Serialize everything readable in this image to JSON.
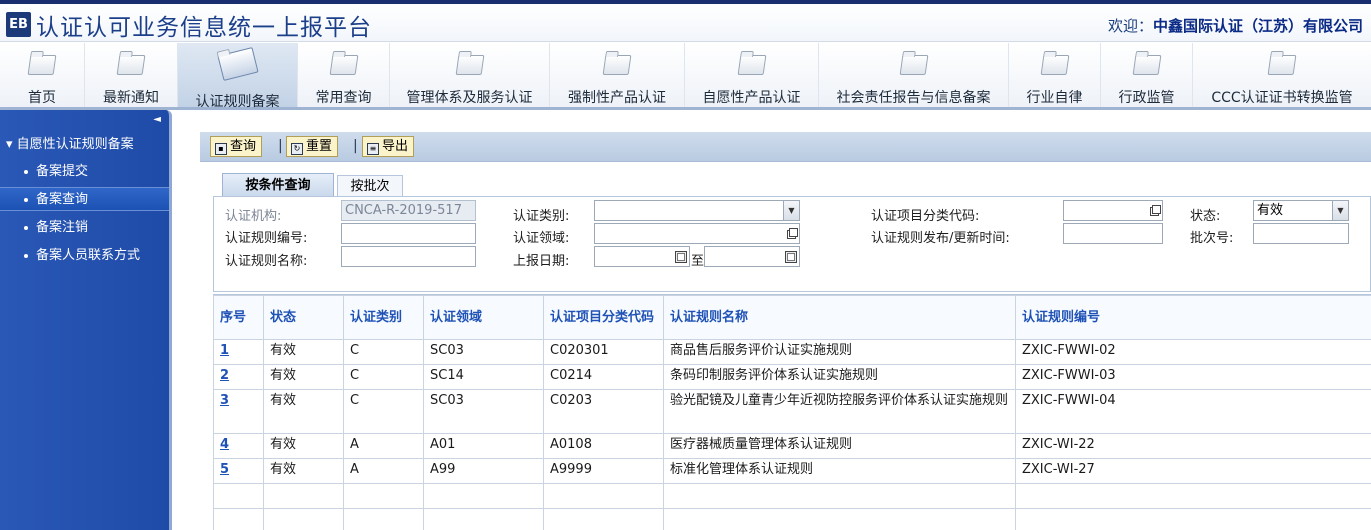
{
  "header": {
    "logo": "EB",
    "title": "认证认可业务信息统一上报平台",
    "welcome_label": "欢迎：",
    "welcome_name": "中鑫国际认证（江苏）有限公司"
  },
  "nav": {
    "items": [
      {
        "label": "首页"
      },
      {
        "label": "最新通知"
      },
      {
        "label": "认证规则备案"
      },
      {
        "label": "常用查询"
      },
      {
        "label": "管理体系及服务认证"
      },
      {
        "label": "强制性产品认证"
      },
      {
        "label": "自愿性产品认证"
      },
      {
        "label": "社会责任报告与信息备案"
      },
      {
        "label": "行业自律"
      },
      {
        "label": "行政监管"
      },
      {
        "label": "CCC认证证书转换监管"
      }
    ],
    "active_index": 2
  },
  "sidebar": {
    "toggle": "◄",
    "group": "▾ 自愿性认证规则备案",
    "items": [
      {
        "label": "备案提交"
      },
      {
        "label": "备案查询"
      },
      {
        "label": "备案注销"
      },
      {
        "label": "备案人员联系方式"
      }
    ],
    "active_index": 1
  },
  "toolbar": {
    "query_label": "查询",
    "reset_label": "重置",
    "export_label": "导出",
    "separator": "|"
  },
  "tabs": {
    "by_condition": "按条件查询",
    "by_batch": "按批次"
  },
  "form": {
    "org_label": "认证机构:",
    "org_value": "CNCA-R-2019-517",
    "rule_no_label": "认证规则编号:",
    "rule_name_label": "认证规则名称:",
    "category_label": "认证类别:",
    "field_label": "认证领域:",
    "report_date_label": "上报日期:",
    "date_to": "至",
    "item_code_label": "认证项目分类代码:",
    "publish_time_label": "认证规则发布/更新时间:",
    "status_label": "状态:",
    "status_value": "有效",
    "batch_label": "批次号:"
  },
  "table": {
    "headers": [
      "序号",
      "状态",
      "认证类别",
      "认证领域",
      "认证项目分类代码",
      "认证规则名称",
      "认证规则编号"
    ],
    "rows": [
      {
        "no": "1",
        "status": "有效",
        "category": "C",
        "field": "SC03",
        "code": "C020301",
        "name": "商品售后服务评价认证实施规则",
        "rule_no": "ZXIC-FWWI-02"
      },
      {
        "no": "2",
        "status": "有效",
        "category": "C",
        "field": "SC14",
        "code": "C0214",
        "name": "条码印制服务评价体系认证实施规则",
        "rule_no": "ZXIC-FWWI-03"
      },
      {
        "no": "3",
        "status": "有效",
        "category": "C",
        "field": "SC03",
        "code": "C0203",
        "name": "验光配镜及儿童青少年近视防控服务评价体系认证实施规则",
        "rule_no": "ZXIC-FWWI-04"
      },
      {
        "no": "4",
        "status": "有效",
        "category": "A",
        "field": "A01",
        "code": "A0108",
        "name": "医疗器械质量管理体系认证规则",
        "rule_no": "ZXIC-WI-22"
      },
      {
        "no": "5",
        "status": "有效",
        "category": "A",
        "field": "A99",
        "code": "A9999",
        "name": "标准化管理体系认证规则",
        "rule_no": "ZXIC-WI-27"
      }
    ]
  }
}
